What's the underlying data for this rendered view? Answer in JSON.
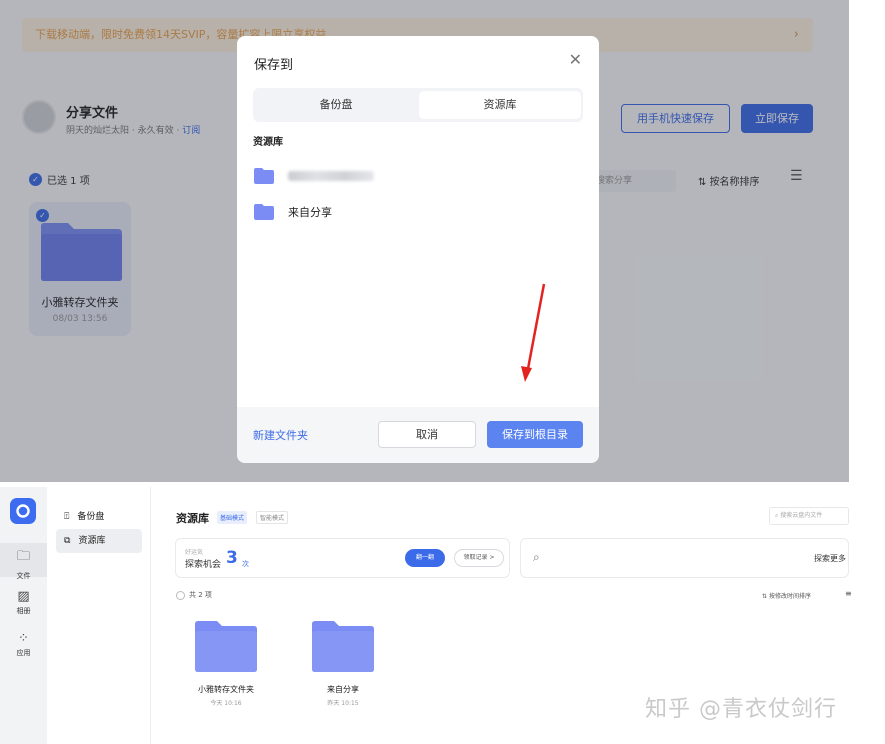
{
  "top_screen": {
    "banner": {
      "text": "下载移动端，限时免费领14天SVIP，容量扩容上限立享权益",
      "chevron": "chevron-right-icon"
    },
    "share": {
      "title": "分享文件",
      "owner": "阴天的灿烂太阳",
      "validity": "永久有效",
      "subscribe": "订阅"
    },
    "actions": {
      "phone_save": "用手机快速保存",
      "save_now": "立即保存"
    },
    "selection": {
      "text": "已选 1 项"
    },
    "search_placeholder": "搜索分享",
    "sort": {
      "label": "按名称排序"
    },
    "folder_card": {
      "name": "小雅转存文件夹",
      "date": "08/03 13:56"
    }
  },
  "dialog": {
    "title": "保存到",
    "tabs": [
      {
        "label": "备份盘"
      },
      {
        "label": "资源库"
      }
    ],
    "active_tab": "资源库",
    "section_title": "资源库",
    "items": [
      {
        "label": ""
      },
      {
        "label": "来自分享"
      }
    ],
    "new_folder": "新建文件夹",
    "cancel": "取消",
    "save_root": "保存到根目录"
  },
  "bottom_screen": {
    "rail": [
      {
        "label": "文件",
        "icon": "folder-icon"
      },
      {
        "label": "相册",
        "icon": "image-icon"
      },
      {
        "label": "应用",
        "icon": "apps-icon"
      }
    ],
    "nav": [
      {
        "label": "备份盘",
        "icon": "backup-icon"
      },
      {
        "label": "资源库",
        "icon": "library-icon"
      }
    ],
    "page_title": "资源库",
    "mode_basic": "基础模式",
    "mode_smart": "智能模式",
    "cloud_search_placeholder": "搜索云盘内文件",
    "explore": {
      "hint": "好运気",
      "label": "探索机会",
      "count": "3",
      "unit": "次",
      "flip": "翻一翻",
      "record": "领取记录 >"
    },
    "explore_more": "探索更多",
    "count_text": "共 2 项",
    "sort_label": "按修改时间排序",
    "files": [
      {
        "name": "小雅转存文件夹",
        "date": "今天 10:16"
      },
      {
        "name": "来自分享",
        "date": "昨天 10:15"
      }
    ],
    "watermark": "知乎 @青衣仗剑行"
  },
  "colors": {
    "accent": "#3b6be8",
    "folder": "#7b8df4",
    "banner_text": "#e8a04a"
  }
}
